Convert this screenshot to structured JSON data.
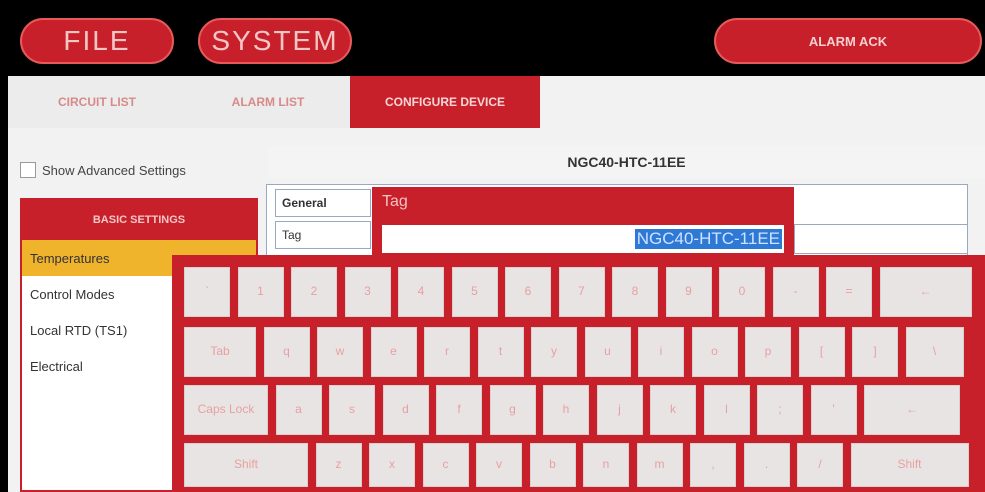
{
  "topbar": {
    "file_label": "FILE",
    "system_label": "SYSTEM",
    "alarm_ack_label": "ALARM ACK"
  },
  "tabs": [
    {
      "label": "CIRCUIT LIST"
    },
    {
      "label": "ALARM LIST"
    },
    {
      "label": "CONFIGURE DEVICE",
      "active": true
    }
  ],
  "advanced": {
    "label": "Show Advanced Settings",
    "checked": false
  },
  "sidebar": {
    "header": "BASIC SETTINGS",
    "items": [
      {
        "label": "Temperatures",
        "selected": true
      },
      {
        "label": "Control Modes"
      },
      {
        "label": "Local RTD (TS1)"
      },
      {
        "label": "Electrical"
      }
    ]
  },
  "device": {
    "title": "NGC40-HTC-11EE"
  },
  "grid": {
    "row1": "General",
    "row2": "Tag"
  },
  "tag_popup": {
    "title": "Tag",
    "value": "NGC40-HTC-11EE"
  },
  "keyboard": {
    "row1": [
      "`",
      "1",
      "2",
      "3",
      "4",
      "5",
      "6",
      "7",
      "8",
      "9",
      "0",
      "-",
      "=",
      "←"
    ],
    "row2": [
      "Tab",
      "q",
      "w",
      "e",
      "r",
      "t",
      "y",
      "u",
      "i",
      "o",
      "p",
      "[",
      "]",
      "\\"
    ],
    "row3": [
      "Caps Lock",
      "a",
      "s",
      "d",
      "f",
      "g",
      "h",
      "j",
      "k",
      "l",
      ";",
      "'",
      "←"
    ],
    "row4": [
      "Shift",
      "z",
      "x",
      "c",
      "v",
      "b",
      "n",
      "m",
      ",",
      ".",
      "/",
      "Shift"
    ]
  },
  "colors": {
    "accent": "#c8202a",
    "selected": "#f0b32c",
    "highlight": "#2e79d6"
  }
}
